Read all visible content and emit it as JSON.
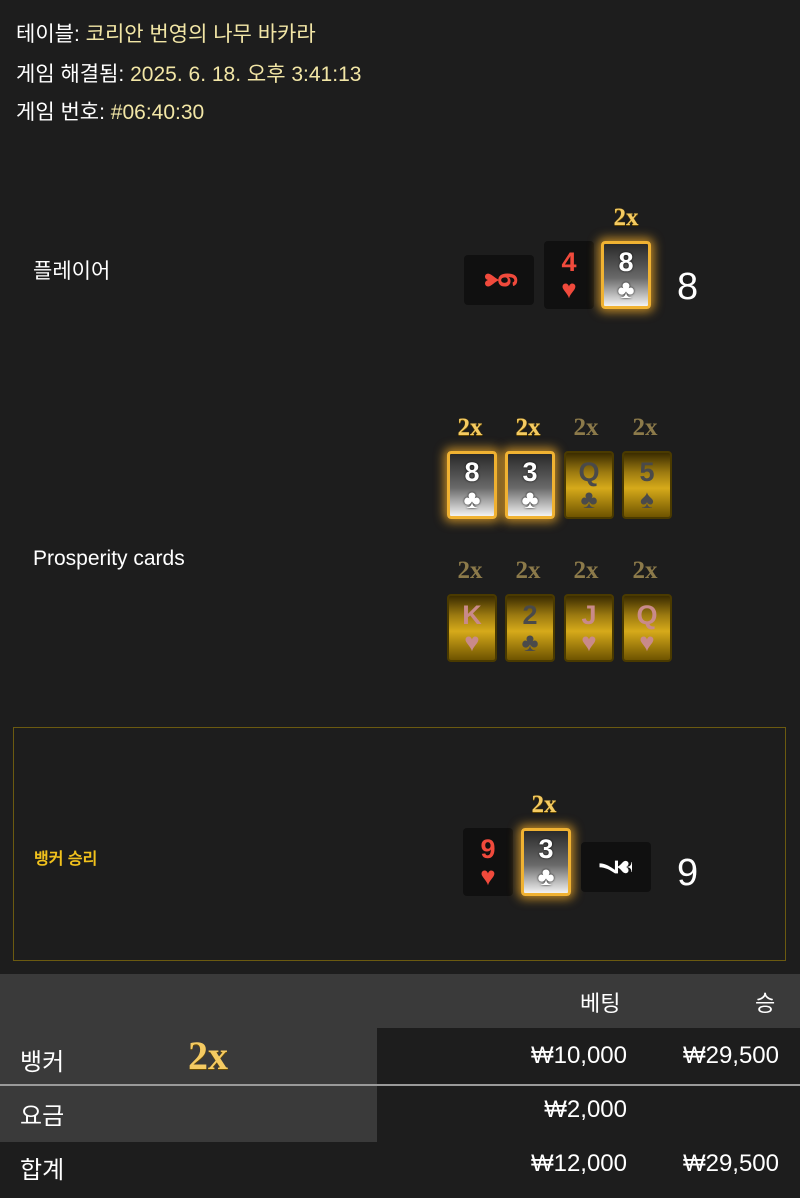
{
  "header": {
    "table_label": "테이블:",
    "table_value": "코리안 번영의 나무 바카라",
    "resolved_label": "게임 해결됨:",
    "resolved_value": "2025. 6. 18. 오후 3:41:13",
    "round_label": "게임 번호:",
    "round_value": "#06:40:30"
  },
  "player": {
    "label": "플레이어",
    "total": "8",
    "cards": [
      {
        "rank": "6",
        "suit": "♥",
        "color": "red",
        "orientation": "sideways"
      },
      {
        "rank": "4",
        "suit": "♥",
        "color": "red",
        "orientation": "upright"
      },
      {
        "rank": "8",
        "suit": "♣",
        "color": "black",
        "orientation": "upright",
        "multiplier": "2x",
        "highlighted": true
      }
    ]
  },
  "prosperity": {
    "label": "Prosperity cards",
    "row1": [
      {
        "rank": "8",
        "suit": "♣",
        "multiplier": "2x",
        "active": true
      },
      {
        "rank": "3",
        "suit": "♣",
        "multiplier": "2x",
        "active": true
      },
      {
        "rank": "Q",
        "suit": "♣",
        "multiplier": "2x",
        "active": false
      },
      {
        "rank": "5",
        "suit": "♠",
        "multiplier": "2x",
        "active": false
      }
    ],
    "row2": [
      {
        "rank": "K",
        "suit": "♥",
        "multiplier": "2x",
        "active": false
      },
      {
        "rank": "2",
        "suit": "♣",
        "multiplier": "2x",
        "active": false
      },
      {
        "rank": "J",
        "suit": "♥",
        "multiplier": "2x",
        "active": false
      },
      {
        "rank": "Q",
        "suit": "♥",
        "multiplier": "2x",
        "active": false
      }
    ]
  },
  "banker": {
    "label": "뱅커 승리",
    "total": "9",
    "cards": [
      {
        "rank": "9",
        "suit": "♥",
        "color": "red",
        "orientation": "upright"
      },
      {
        "rank": "3",
        "suit": "♣",
        "color": "black",
        "orientation": "upright",
        "multiplier": "2x",
        "highlighted": true
      },
      {
        "rank": "7",
        "suit": "♠",
        "color": "black",
        "orientation": "sideways"
      }
    ]
  },
  "bets_table": {
    "columns": {
      "bet": "베팅",
      "win": "승"
    },
    "rows": [
      {
        "name": "뱅커",
        "multiplier": "2x",
        "bet": "₩10,000",
        "win": "₩29,500"
      },
      {
        "name": "요금",
        "bet": "₩2,000",
        "win": ""
      }
    ],
    "total": {
      "name": "합계",
      "bet": "₩12,000",
      "win": "₩29,500"
    }
  },
  "colors": {
    "background": "#1d1d1d",
    "gold": "#f5cb62",
    "winner": "#f2c21c",
    "red_suit": "#f04a3c"
  }
}
